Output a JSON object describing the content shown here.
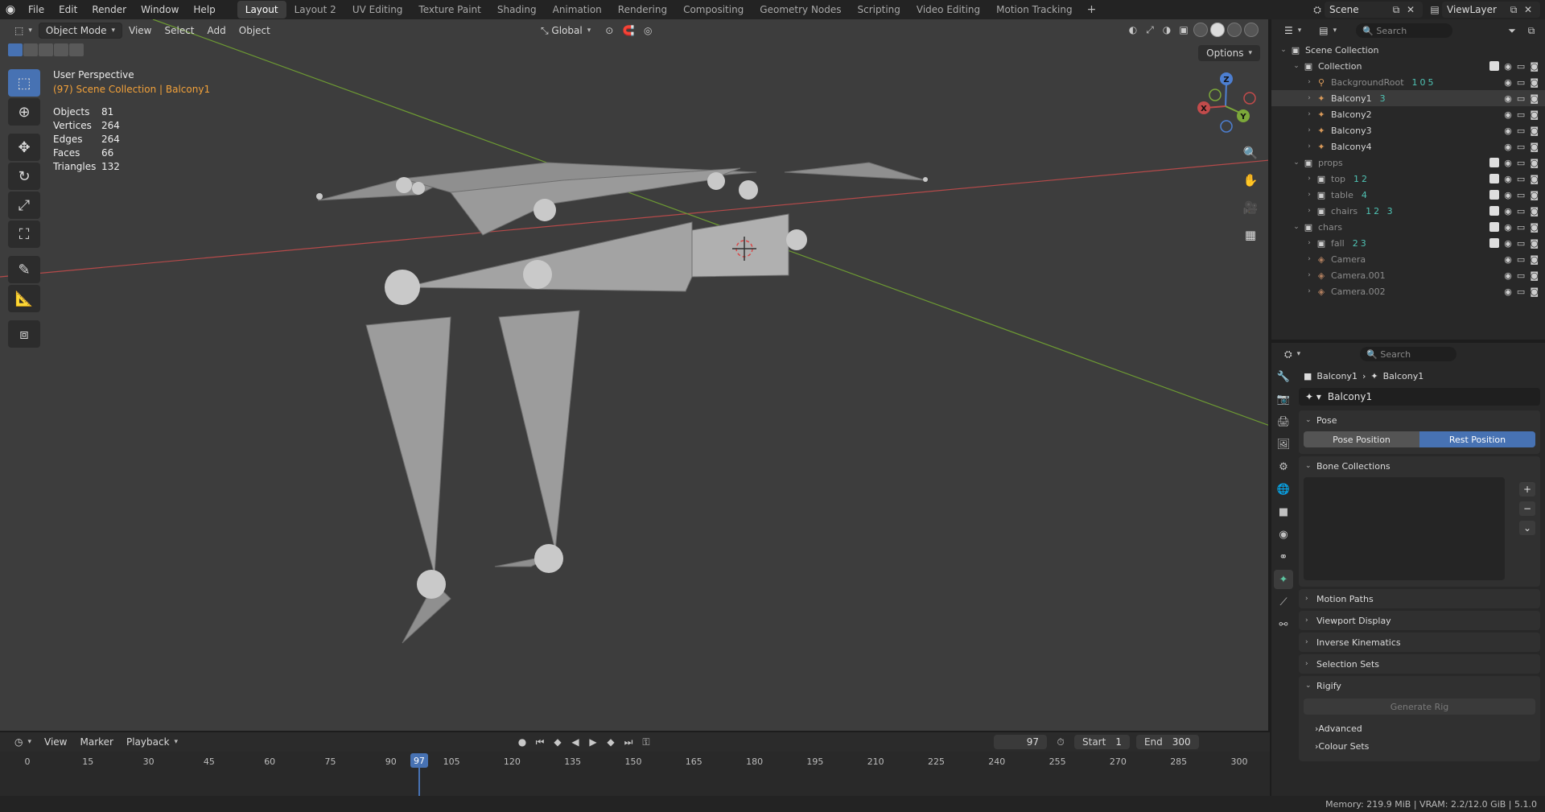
{
  "menubar": {
    "menus": [
      "File",
      "Edit",
      "Render",
      "Window",
      "Help"
    ],
    "workspaces": [
      "Layout",
      "Layout 2",
      "UV Editing",
      "Texture Paint",
      "Shading",
      "Animation",
      "Rendering",
      "Compositing",
      "Geometry Nodes",
      "Scripting",
      "Video Editing",
      "Motion Tracking"
    ],
    "active_workspace": "Layout",
    "add_tab": "+",
    "scene": "Scene",
    "view_layer": "ViewLayer"
  },
  "viewport": {
    "mode": "Object Mode",
    "menus": [
      "View",
      "Select",
      "Add",
      "Object"
    ],
    "orientation": "Global",
    "options": "Options",
    "info_title": "User Perspective",
    "info_context": "(97) Scene Collection | Balcony1",
    "stats": [
      {
        "label": "Objects",
        "value": "81"
      },
      {
        "label": "Vertices",
        "value": "264"
      },
      {
        "label": "Edges",
        "value": "264"
      },
      {
        "label": "Faces",
        "value": "66"
      },
      {
        "label": "Triangles",
        "value": "132"
      }
    ],
    "gizmo_axes": {
      "x": "X",
      "y": "Y",
      "z": "Z"
    },
    "colors": {
      "x_axis": "#c24b4b",
      "y_axis": "#7ca83a",
      "selected": "#f2a13a"
    }
  },
  "timeline": {
    "menus": [
      "View",
      "Marker",
      "Playback"
    ],
    "current_frame": "97",
    "start_label": "Start",
    "start": "1",
    "end_label": "End",
    "end": "300",
    "ticks": [
      "0",
      "15",
      "30",
      "45",
      "60",
      "75",
      "90",
      "105",
      "120",
      "135",
      "150",
      "165",
      "180",
      "195",
      "210",
      "225",
      "240",
      "255",
      "270",
      "285",
      "300"
    ]
  },
  "outliner": {
    "search_placeholder": "Search",
    "rows": [
      {
        "label": "Scene Collection",
        "level": 0,
        "icon": "collection-icon",
        "glyph": "▣",
        "dim": false
      },
      {
        "label": "Collection",
        "level": 1,
        "icon": "collection-icon",
        "glyph": "▣",
        "dim": false
      },
      {
        "label": "BackgroundRoot",
        "level": 2,
        "icon": "armature-icon",
        "glyph": "⚲",
        "dim": true,
        "extra": "105"
      },
      {
        "label": "Balcony1",
        "level": 2,
        "icon": "armature-icon",
        "glyph": "✦",
        "dim": false,
        "extra": "3",
        "selected": true
      },
      {
        "label": "Balcony2",
        "level": 2,
        "icon": "armature-icon",
        "glyph": "✦",
        "dim": false
      },
      {
        "label": "Balcony3",
        "level": 2,
        "icon": "armature-icon",
        "glyph": "✦",
        "dim": false
      },
      {
        "label": "Balcony4",
        "level": 2,
        "icon": "armature-icon",
        "glyph": "✦",
        "dim": false
      },
      {
        "label": "props",
        "level": 1,
        "icon": "collection-icon",
        "glyph": "▣",
        "dim": true
      },
      {
        "label": "top",
        "level": 2,
        "icon": "collection-icon",
        "glyph": "▣",
        "dim": true,
        "extra": "12"
      },
      {
        "label": "table",
        "level": 2,
        "icon": "collection-icon",
        "glyph": "▣",
        "dim": true,
        "extra": "4"
      },
      {
        "label": "chairs",
        "level": 2,
        "icon": "collection-icon",
        "glyph": "▣",
        "dim": true,
        "extra": "12 3"
      },
      {
        "label": "chars",
        "level": 1,
        "icon": "collection-icon",
        "glyph": "▣",
        "dim": true
      },
      {
        "label": "fall",
        "level": 2,
        "icon": "collection-icon",
        "glyph": "▣",
        "dim": true,
        "extra": "23"
      },
      {
        "label": "Camera",
        "level": 2,
        "icon": "camera-icon",
        "glyph": "◈",
        "dim": true
      },
      {
        "label": "Camera.001",
        "level": 2,
        "icon": "camera-icon",
        "glyph": "◈",
        "dim": true
      },
      {
        "label": "Camera.002",
        "level": 2,
        "icon": "camera-icon",
        "glyph": "◈",
        "dim": true
      }
    ]
  },
  "properties": {
    "search_placeholder": "Search",
    "breadcrumb_object": "Balcony1",
    "breadcrumb_data": "Balcony1",
    "data_name": "Balcony1",
    "pose_panel": "Pose",
    "pose_position": "Pose Position",
    "rest_position": "Rest Position",
    "bone_collections": "Bone Collections",
    "collapsed_panels": [
      "Motion Paths",
      "Viewport Display",
      "Inverse Kinematics",
      "Selection Sets"
    ],
    "rigify": "Rigify",
    "generate_rig": "Generate Rig",
    "rigify_sub": [
      "Advanced",
      "Colour Sets"
    ]
  },
  "statusbar": "Memory: 219.9 MiB | VRAM: 2.2/12.0 GiB | 5.1.0"
}
